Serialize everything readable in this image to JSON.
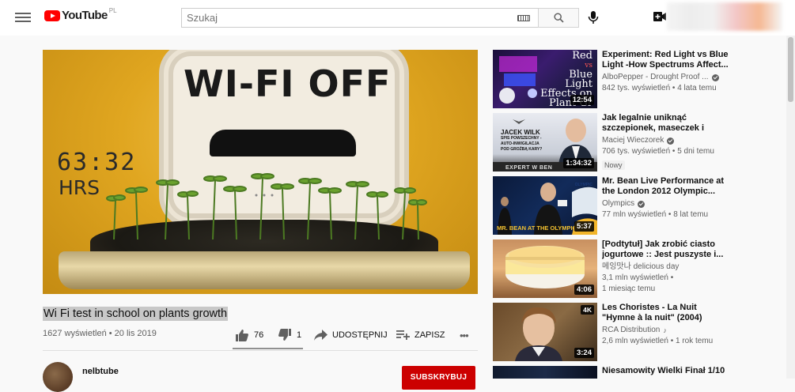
{
  "header": {
    "logo_text": "YouTube",
    "logo_country": "PL",
    "search_placeholder": "Szukaj",
    "icons": [
      "menu-icon",
      "keyboard-icon",
      "search-icon",
      "mic-icon",
      "create-video-icon"
    ]
  },
  "player": {
    "overlay_text_main": "WI-FI OFF",
    "overlay_time": "63:32",
    "overlay_unit": "HRS"
  },
  "video": {
    "title": "Wi Fi test in school on plants growth",
    "views_date": "1627 wyświetleń • 20 lis 2019",
    "like_count": "76",
    "dislike_count": "1",
    "share_label": "UDOSTĘPNIJ",
    "save_label": "ZAPISZ",
    "more_label": "•••"
  },
  "channel": {
    "name": "nelbtube",
    "subscribe_label": "SUBSKRYBUJ"
  },
  "recommendations": [
    {
      "title": "Experiment: Red Light vs Blue Light -How Spectrums Affect...",
      "channel": "AlboPepper - Drought Proof ...",
      "verified": true,
      "meta": "842 tys. wyświetleń • 4 lata temu",
      "duration": "12:54",
      "thumb_text": "Red vs Blue Light Effects on Plant Gr",
      "thumb_caption_lines": [
        "Red",
        "vs",
        "Blue",
        "Light",
        "Effects on",
        "Plant Gr"
      ]
    },
    {
      "title": "Jak legalnie uniknąć szczepionek, maseczek i spis...",
      "channel": "Maciej Wieczorek",
      "verified": true,
      "meta": "706 tys. wyświetleń • 5 dni temu",
      "badge": "Nowy",
      "duration": "1:34:32",
      "thumb_caption_lines": [
        "JACEK WILK",
        "SPIS POWSZECHNY -",
        "AUTO-INWIGILACJA",
        "POD GROŹBĄ KARY?",
        "EXPERT W BEN"
      ]
    },
    {
      "title": "Mr. Bean Live Performance at the London 2012 Olympic...",
      "channel": "Olympics",
      "verified": true,
      "meta": "77 mln wyświetleń • 8 lat temu",
      "duration": "5:37",
      "thumb_caption_lines": [
        "MR. BEAN AT THE OLYMPICS",
        "OLYMPIC"
      ]
    },
    {
      "title": "[Podtytuł] Jak zrobić ciasto jogurtowe :: Jest puszyste i...",
      "channel": "메잉맛나 delicious day",
      "verified": false,
      "meta_line1": "3,1 mln wyświetleń •",
      "meta_line2": "1 miesiąc temu",
      "duration": "4:06"
    },
    {
      "title": "Les Choristes - La Nuit \"Hymne à la nuit\" (2004)",
      "channel": "RCA Distribution",
      "verified": false,
      "music_note": "♪",
      "meta": "2,6 mln wyświetleń • 1 rok temu",
      "duration": "3:24",
      "badge_4k": "4K"
    },
    {
      "title": "Niesamowity Wielki Finał 1/10"
    }
  ]
}
